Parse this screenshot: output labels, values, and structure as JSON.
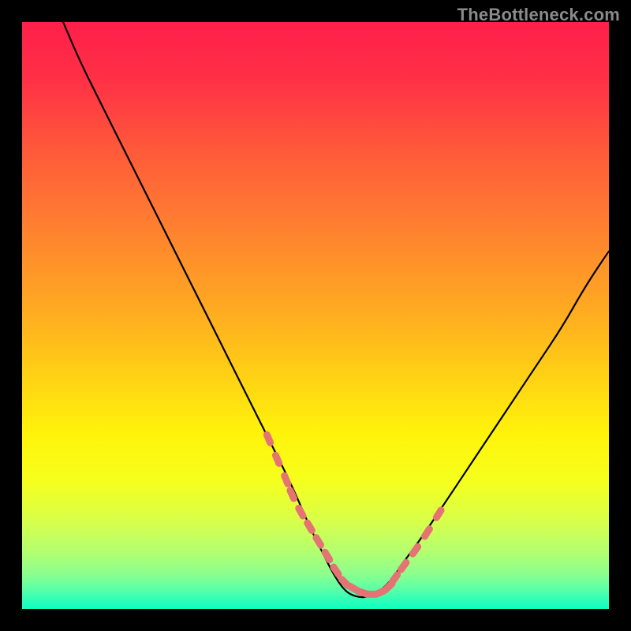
{
  "watermark": "TheBottleneck.com",
  "gradient_stops": [
    {
      "offset": 0.0,
      "color": "#ff1f4b"
    },
    {
      "offset": 0.1,
      "color": "#ff3145"
    },
    {
      "offset": 0.22,
      "color": "#ff5a3a"
    },
    {
      "offset": 0.35,
      "color": "#ff8030"
    },
    {
      "offset": 0.48,
      "color": "#ffa722"
    },
    {
      "offset": 0.6,
      "color": "#ffd015"
    },
    {
      "offset": 0.7,
      "color": "#fff30a"
    },
    {
      "offset": 0.78,
      "color": "#f6ff1c"
    },
    {
      "offset": 0.85,
      "color": "#d8ff4a"
    },
    {
      "offset": 0.9,
      "color": "#b5ff6e"
    },
    {
      "offset": 0.94,
      "color": "#8cff8d"
    },
    {
      "offset": 0.965,
      "color": "#5effa5"
    },
    {
      "offset": 0.985,
      "color": "#2effb8"
    },
    {
      "offset": 1.0,
      "color": "#10ffbf"
    }
  ],
  "chart_data": {
    "type": "line",
    "title": "",
    "xlabel": "",
    "ylabel": "",
    "xlim": [
      0,
      100
    ],
    "ylim": [
      0,
      100
    ],
    "grid": false,
    "series": [
      {
        "name": "bottleneck-curve",
        "color": "#000000",
        "x": [
          7,
          10,
          14,
          18,
          22,
          26,
          30,
          34,
          38,
          42,
          46,
          49,
          51,
          53,
          55,
          57,
          59,
          61,
          63,
          65,
          68,
          72,
          76,
          80,
          84,
          88,
          92,
          96,
          100
        ],
        "y": [
          100,
          93,
          85,
          77,
          69,
          61,
          53,
          45,
          37,
          29,
          21,
          14,
          10,
          6,
          3,
          2,
          2,
          3,
          5,
          8,
          12,
          18,
          24,
          30,
          36,
          42,
          48,
          55,
          61
        ]
      },
      {
        "name": "marker-points",
        "color": "#e57373",
        "marker_only": true,
        "x": [
          42,
          43.5,
          45,
          46,
          47.5,
          49,
          50.5,
          52,
          53.5,
          55,
          56.5,
          58,
          59.5,
          61,
          62.5,
          63.5,
          65,
          67,
          69,
          71
        ],
        "y": [
          29,
          25.5,
          22,
          19.5,
          16.5,
          14,
          11.5,
          9,
          6.5,
          4.5,
          3.5,
          2.8,
          2.5,
          2.8,
          3.8,
          5.2,
          7.3,
          10,
          13,
          16.2
        ]
      }
    ]
  }
}
